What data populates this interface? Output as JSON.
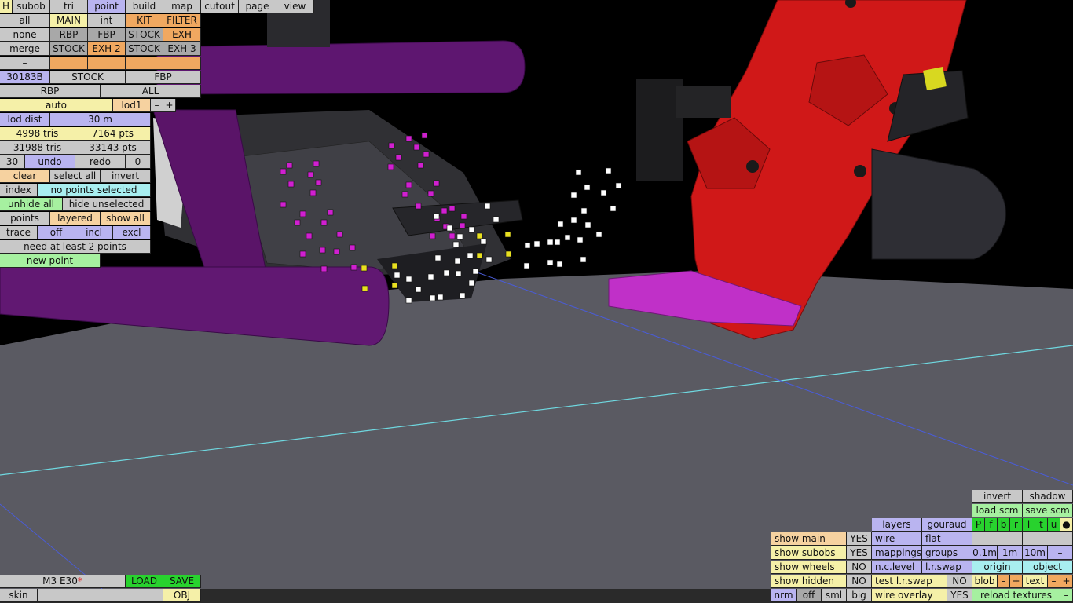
{
  "colors": {
    "ground": "#5a5a62",
    "sky": "#000000",
    "purple_part": "#5e1670",
    "red_part": "#d01818",
    "dark_part": "#2c2c30",
    "magenta_point": "#d020d0",
    "yellow_point": "#e8e020",
    "white_point": "#ffffff"
  },
  "menu": {
    "h": "H",
    "tabs": [
      "subob",
      "tri",
      "point",
      "build",
      "map",
      "cutout",
      "page",
      "view"
    ],
    "active_tab": "point"
  },
  "sel": {
    "row1": [
      "all",
      "MAIN",
      "int",
      "KIT",
      "FILTER"
    ],
    "row2": [
      "none",
      "RBP",
      "FBP",
      "STOCK",
      "EXH"
    ],
    "row3": [
      "merge",
      "STOCK",
      "EXH 2",
      "STOCK",
      "EXH 3"
    ],
    "row4_first": "–"
  },
  "info": {
    "id": "30183B",
    "stock": "STOCK",
    "fbp": "FBP",
    "rbp": "RBP",
    "all": "ALL",
    "auto": "auto",
    "lod": "lod1",
    "minus": "–",
    "plus": "+",
    "lod_dist_label": "lod dist",
    "lod_dist_value": "30 m",
    "tris1": "4998 tris",
    "pts1": "7164 pts",
    "tris2": "31988 tris",
    "pts2": "33143 pts",
    "undo_count": "30",
    "undo": "undo",
    "redo": "redo",
    "redo_count": "0"
  },
  "tools": {
    "clear": "clear",
    "select_all": "select all",
    "invert": "invert",
    "index": "index",
    "index_status": "no points selected",
    "unhide_all": "unhide all",
    "hide_unselected": "hide unselected",
    "points": "points",
    "layered": "layered",
    "show_all": "show all",
    "trace": "trace",
    "off": "off",
    "incl": "incl",
    "excl": "excl",
    "need": "need at least 2 points",
    "new_point": "new point"
  },
  "file": {
    "name": "M3 E30",
    "modified_mark": "*",
    "load": "LOAD",
    "save": "SAVE",
    "skin": "skin",
    "obj": "OBJ"
  },
  "view": {
    "invert": "invert",
    "shadow": "shadow",
    "load_scm": "load scm",
    "save_scm": "save scm",
    "flags": [
      "P",
      "f",
      "b",
      "r",
      "l",
      "t",
      "u",
      "●"
    ],
    "layers": "layers",
    "gouraud": "gouraud",
    "wire": "wire",
    "flat": "flat",
    "mappings": "mappings",
    "groups": "groups",
    "nclevel": "n.c.level",
    "lrswap": "l.r.swap",
    "test_lrswap": "test l.r.swap",
    "test_lrswap_val": "NO",
    "wire_overlay": "wire overlay",
    "wire_overlay_val": "YES",
    "show_main": "show main",
    "show_main_val": "YES",
    "show_subobs": "show subobs",
    "show_subobs_val": "YES",
    "show_wheels": "show wheels",
    "show_wheels_val": "NO",
    "show_hidden": "show hidden",
    "show_hidden_val": "NO",
    "dash": "–",
    "m01": "0.1m",
    "m1": "1m",
    "m10": "10m",
    "origin": "origin",
    "object": "object",
    "blob": "blob",
    "text": "text",
    "plus": "+",
    "nrm": "nrm",
    "off": "off",
    "sml": "sml",
    "big": "big",
    "reload": "reload textures"
  }
}
